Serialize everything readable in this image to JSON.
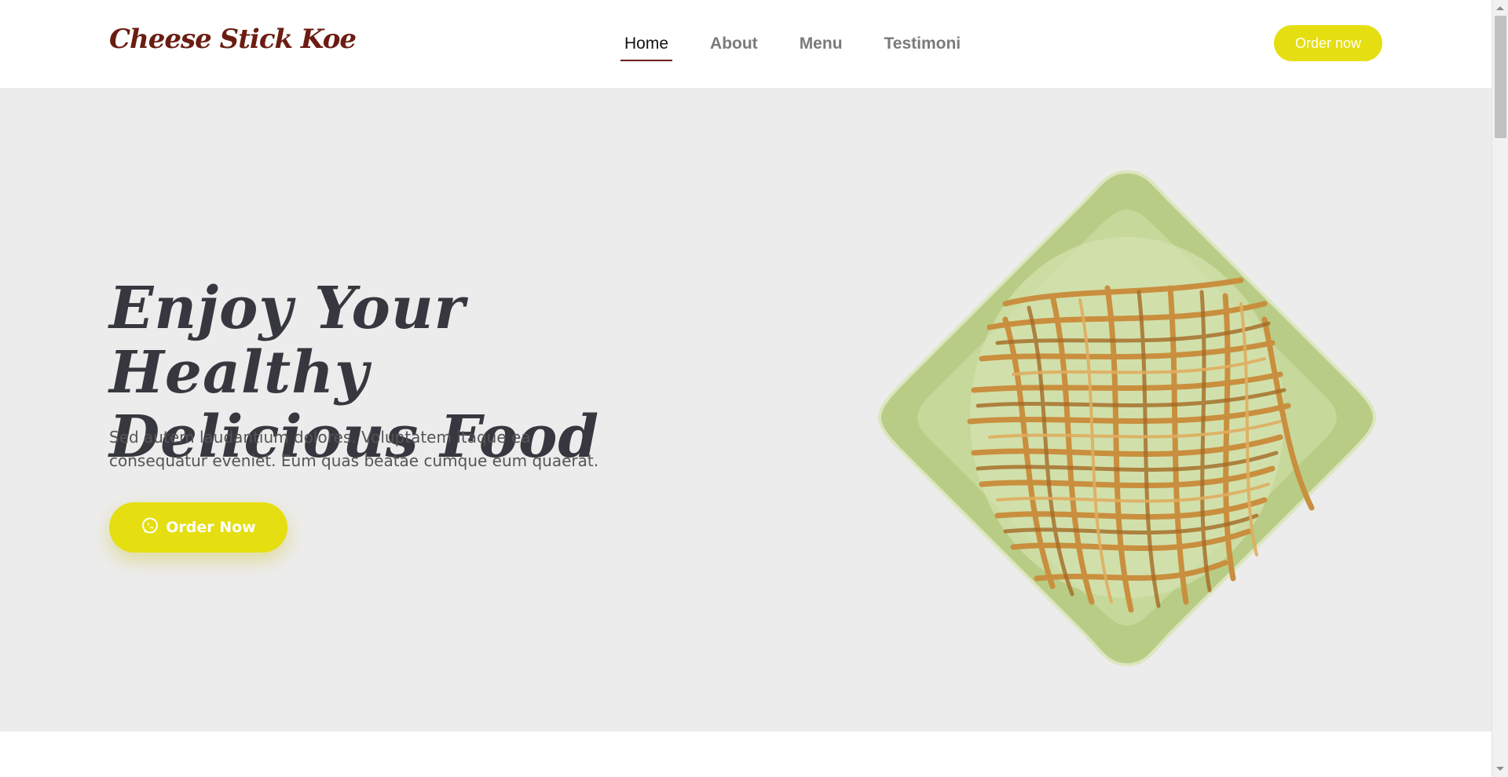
{
  "brand": {
    "name": "Cheese Stick Koe",
    "color": "#6b1d12"
  },
  "nav": {
    "items": [
      {
        "label": "Home",
        "active": true
      },
      {
        "label": "About",
        "active": false
      },
      {
        "label": "Menu",
        "active": false
      },
      {
        "label": "Testimoni",
        "active": false
      }
    ]
  },
  "header": {
    "order_button_label": "Order now"
  },
  "hero": {
    "title_line1": "Enjoy Your Healthy",
    "title_line2": "Delicious Food",
    "description": "Sed autem laudantium dolores. Voluptatem itaque ea consequatur eveniet. Eum quas beatae cumque eum quaerat.",
    "order_button_label": "Order Now",
    "order_button_icon": "whatsapp-icon",
    "image_subject": "plate-of-cheese-sticks"
  },
  "colors": {
    "accent": "#e5de10",
    "hero_bg": "#ececec",
    "title": "#37373f",
    "brand": "#6b1d12"
  }
}
